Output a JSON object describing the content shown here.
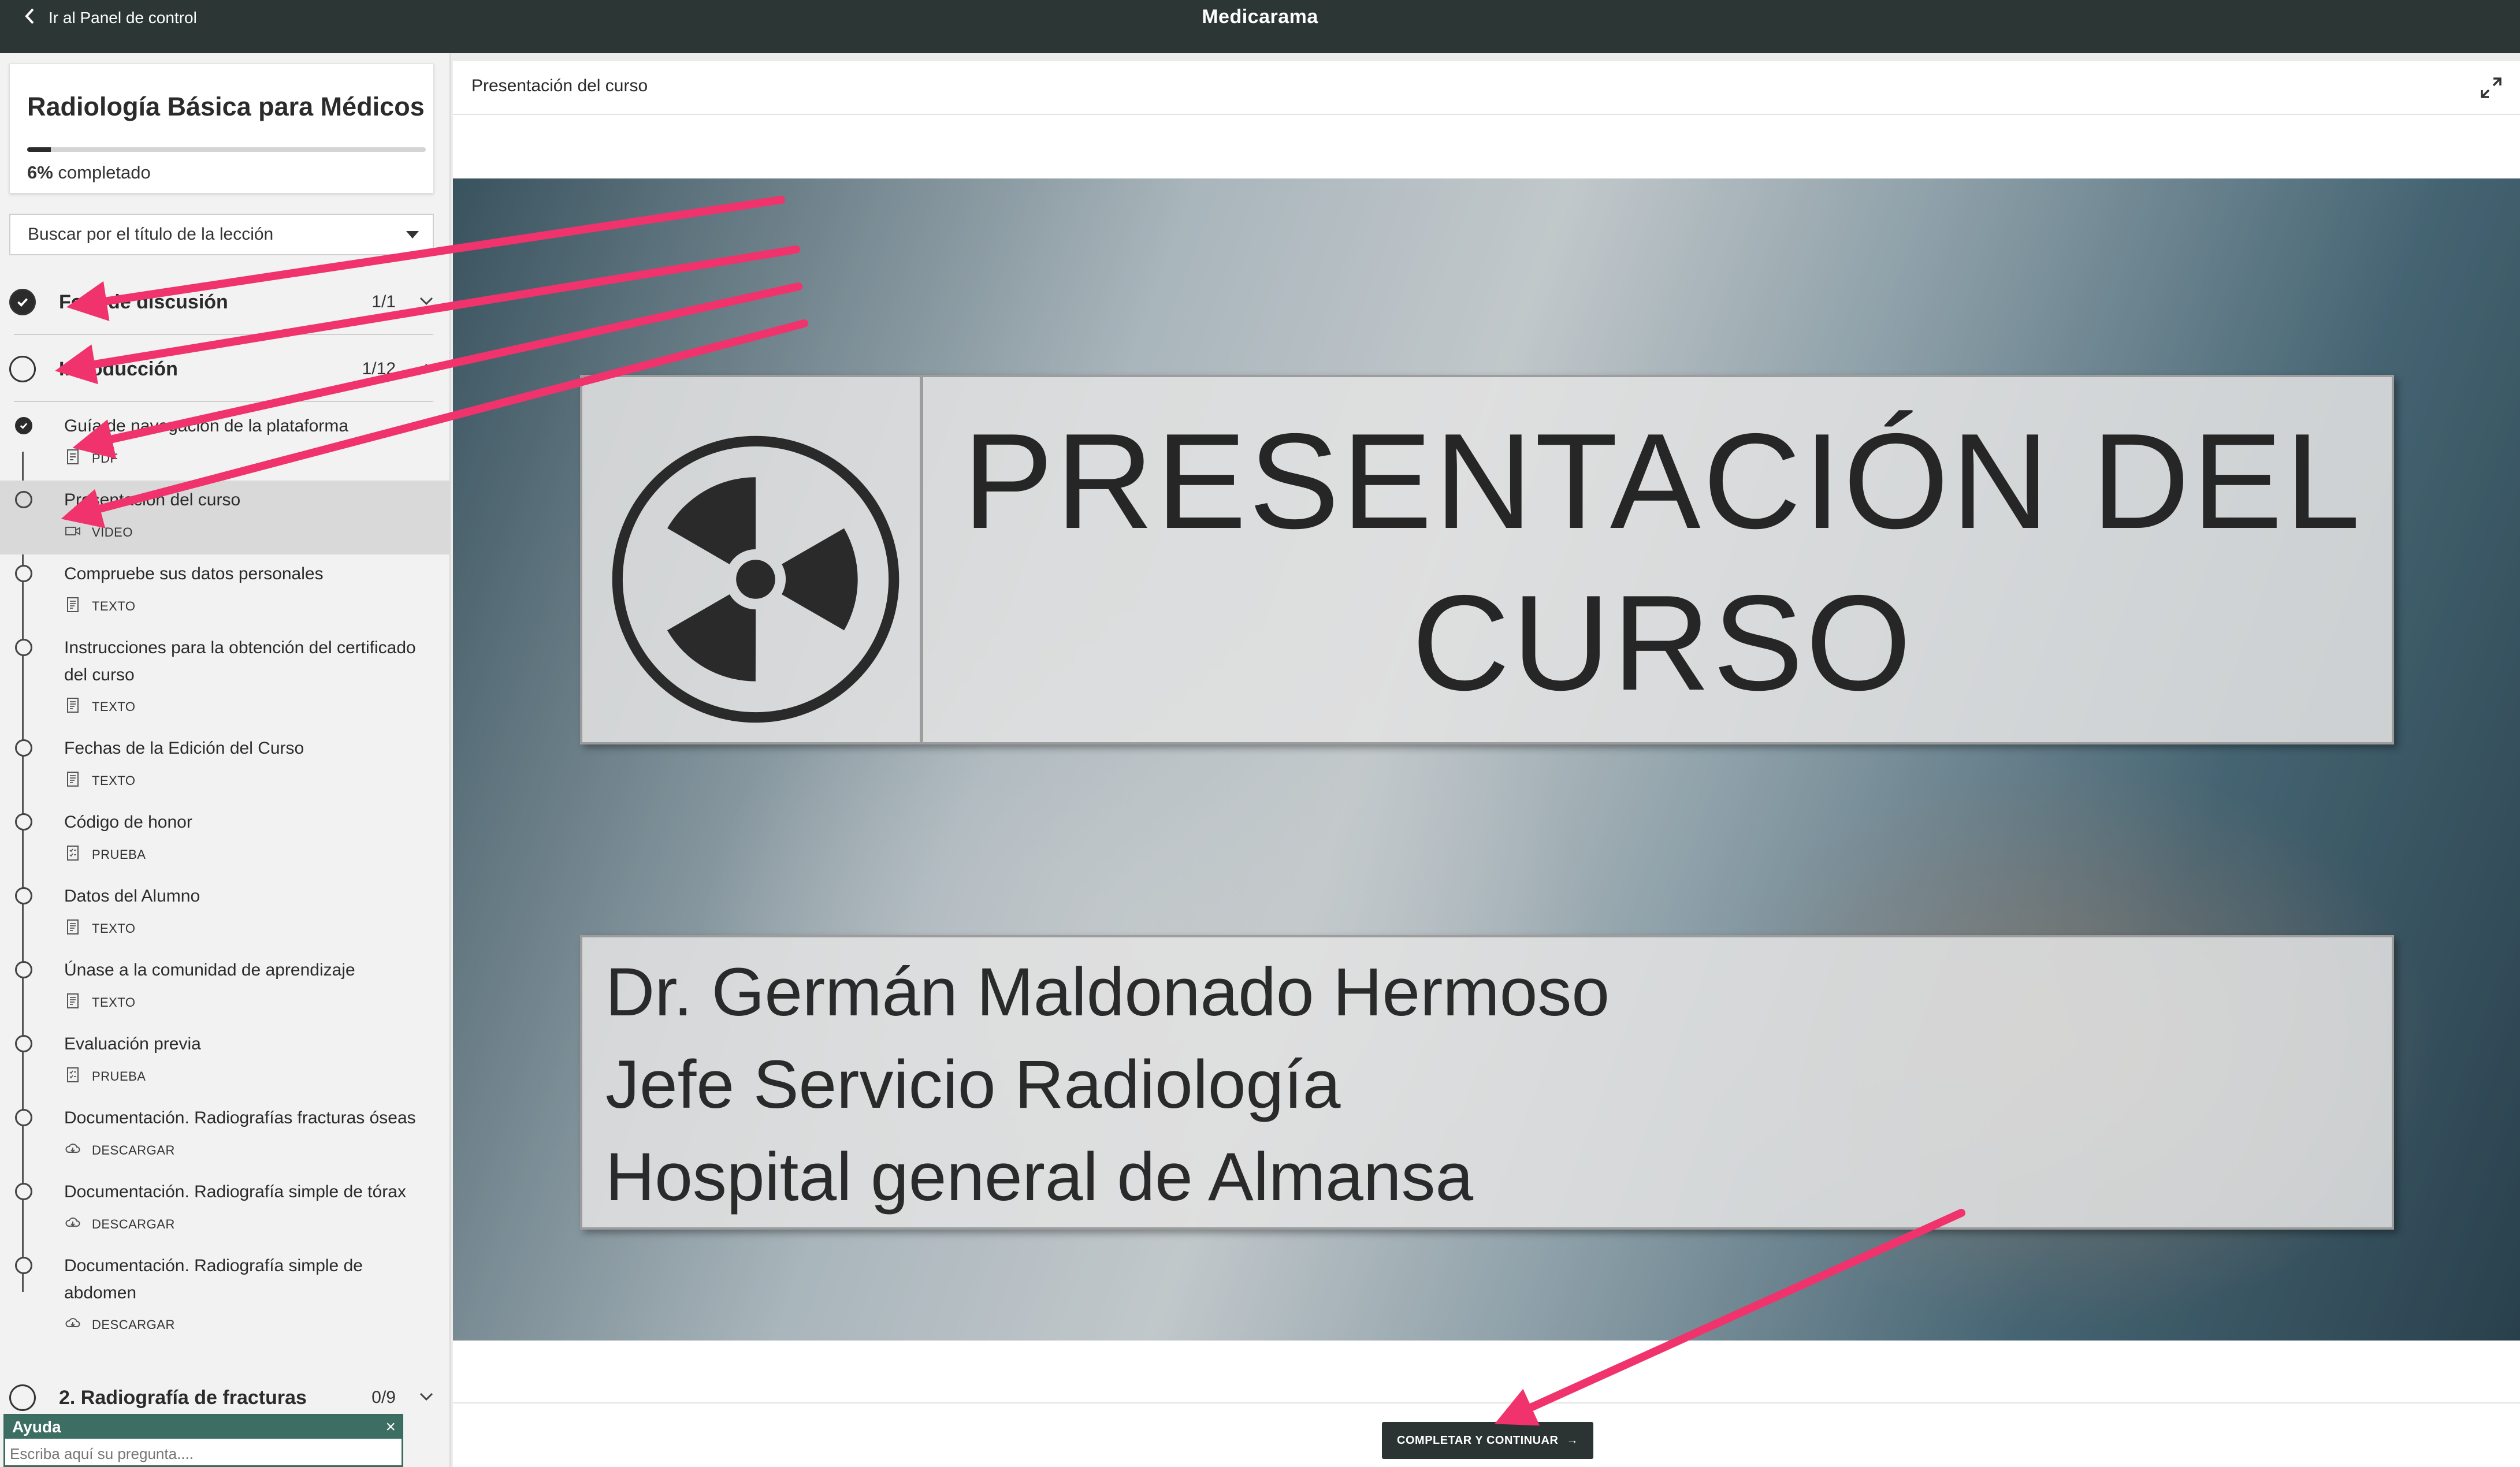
{
  "topbar": {
    "back_label": "Ir al Panel de control",
    "app_title": "Medicarama"
  },
  "sidebar": {
    "course_title": "Radiología Básica para Médicos",
    "progress_percent": "6%",
    "progress_value": 0.06,
    "progress_suffix": " completado",
    "search_placeholder": "Buscar por el título de la lección",
    "sections": [
      {
        "title": "Foro de discusión",
        "count": "1/1",
        "completed": true
      },
      {
        "title": "Introducción",
        "count": "1/12",
        "completed": false
      }
    ],
    "lessons": [
      {
        "title": "Guía de navegación de la plataforma",
        "type": "PDF",
        "type_icon": "pdf-icon",
        "completed": true
      },
      {
        "title": "Presentación del curso",
        "type": "VÍDEO",
        "type_icon": "video-icon",
        "completed": false,
        "active": true
      },
      {
        "title": "Compruebe sus datos personales",
        "type": "TEXTO",
        "type_icon": "text-doc-icon",
        "completed": false
      },
      {
        "title": "Instrucciones para la obtención del certificado del curso",
        "type": "TEXTO",
        "type_icon": "text-doc-icon",
        "completed": false
      },
      {
        "title": "Fechas de la Edición del Curso",
        "type": "TEXTO",
        "type_icon": "text-doc-icon",
        "completed": false
      },
      {
        "title": "Código de honor",
        "type": "PRUEBA",
        "type_icon": "quiz-icon",
        "completed": false
      },
      {
        "title": "Datos del Alumno",
        "type": "TEXTO",
        "type_icon": "text-doc-icon",
        "completed": false
      },
      {
        "title": "Únase a la comunidad de aprendizaje",
        "type": "TEXTO",
        "type_icon": "text-doc-icon",
        "completed": false
      },
      {
        "title": "Evaluación previa",
        "type": "PRUEBA",
        "type_icon": "quiz-icon",
        "completed": false
      },
      {
        "title": "Documentación. Radiografías fracturas óseas",
        "type": "DESCARGAR",
        "type_icon": "cloud-download-icon",
        "completed": false
      },
      {
        "title": "Documentación. Radiografía simple de tórax",
        "type": "DESCARGAR",
        "type_icon": "cloud-download-icon",
        "completed": false
      },
      {
        "title": "Documentación. Radiografía simple de abdomen",
        "type": "DESCARGAR",
        "type_icon": "cloud-download-icon",
        "completed": false
      }
    ],
    "next_section": {
      "title": "2. Radiografía de fracturas",
      "count": "0/9",
      "completed": false
    },
    "help": {
      "title": "Ayuda",
      "close": "×",
      "input_placeholder": "Escriba aquí su pregunta...."
    }
  },
  "main": {
    "lesson_heading": "Presentación del curso",
    "slide": {
      "title_line1": "PRESENTACIÓN DEL",
      "title_line2": "CURSO",
      "author_line1": "Dr. Germán Maldonado Hermoso",
      "author_line2": "Jefe Servicio  Radiología",
      "author_line3": "Hospital general de Almansa"
    },
    "complete_button": "COMPLETAR Y CONTINUAR",
    "complete_arrow": "→"
  },
  "colors": {
    "topbar": "#2c3634",
    "help_header": "#3d6e64",
    "annotation_arrow": "#f0336c",
    "button": "#2b3433"
  }
}
